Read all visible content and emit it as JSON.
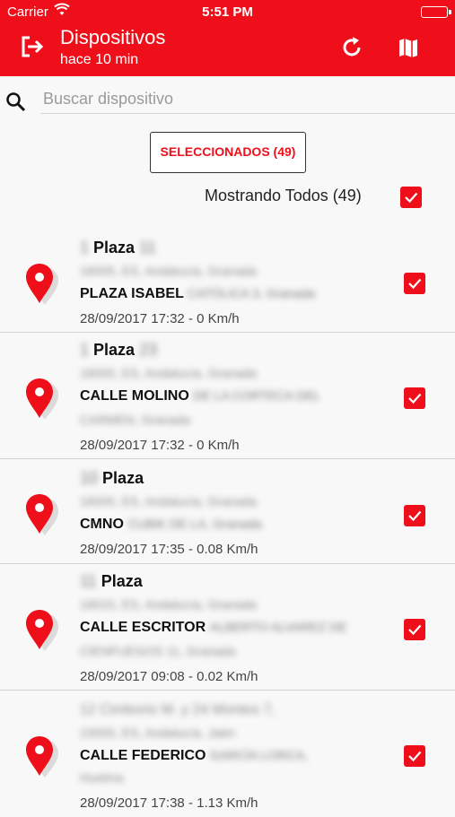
{
  "status_bar": {
    "carrier": "Carrier",
    "time": "5:51 PM"
  },
  "header": {
    "title": "Dispositivos",
    "subtitle": "hace 10 min",
    "icons": [
      "logout-icon",
      "refresh-icon",
      "map-icon"
    ]
  },
  "search": {
    "placeholder": "Buscar dispositivo",
    "value": ""
  },
  "selected_button": {
    "label": "SELECCIONADOS (49)"
  },
  "filter": {
    "label": "Mostrando Todos (49)",
    "checked": true
  },
  "colors": {
    "accent": "#ee0f1a",
    "background": "#f8f8f8"
  },
  "devices": [
    {
      "prefix": "1",
      "name": "Plaza",
      "suffix": "11",
      "region": "18005, ES, Andalucía, Granada",
      "street": "PLAZA ISABEL",
      "street_rest": "CATÓLICA 3, Granada",
      "extra": "",
      "meta": "28/09/2017 17:32 - 0 Km/h",
      "checked": true
    },
    {
      "prefix": "1",
      "name": "Plaza",
      "suffix": "23",
      "region": "18005, ES, Andalucía, Granada",
      "street": "CALLE MOLINO",
      "street_rest": "DE LA CORTECA DEL",
      "extra": "CARMEN, Granada",
      "meta": "28/09/2017 17:32 - 0 Km/h",
      "checked": true
    },
    {
      "prefix": "10",
      "name": "Plaza",
      "suffix": "",
      "region": "18005, ES, Andalucía, Granada",
      "street": "CMNO",
      "street_rest": "CUBIK DE LA, Granada",
      "extra": "",
      "meta": "28/09/2017 17:35 - 0.08 Km/h",
      "checked": true
    },
    {
      "prefix": "11",
      "name": "Plaza",
      "suffix": "",
      "region": "18015, ES, Andalucía, Granada",
      "street": "CALLE ESCRITOR",
      "street_rest": "ALBERTO ALVAREZ DE",
      "extra": "CIENFUEGOS 11, Granada",
      "meta": "28/09/2017 09:08 - 0.02 Km/h",
      "checked": true
    },
    {
      "prefix": "",
      "name": "",
      "suffix": "",
      "header_blur": "12 Cimborio M. y 24 Montes 7,",
      "region": "23005, ES, Andalucía, Jaén",
      "street": "CALLE FEDERICO",
      "street_rest": "GARCÍA LORCA,",
      "extra": "Huelma",
      "meta": "28/09/2017 17:38 - 1.13 Km/h",
      "checked": true
    }
  ]
}
